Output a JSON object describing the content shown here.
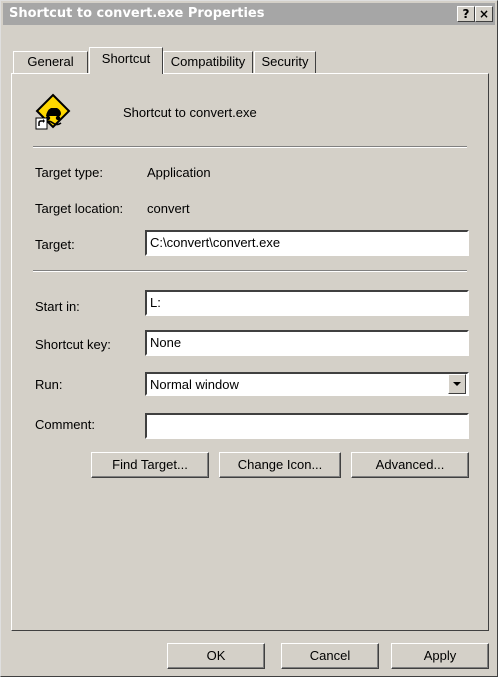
{
  "window": {
    "title": "Shortcut to convert.exe Properties"
  },
  "titlebar": {
    "help_label": "?",
    "close_label": "×"
  },
  "tabs": [
    {
      "label": "General"
    },
    {
      "label": "Shortcut"
    },
    {
      "label": "Compatibility"
    },
    {
      "label": "Security"
    }
  ],
  "header": {
    "name": "Shortcut to convert.exe",
    "icon": "driving-hazard-sign-icon"
  },
  "fields": {
    "target_type_label": "Target type:",
    "target_type_value": "Application",
    "target_location_label": "Target location:",
    "target_location_value": "convert",
    "target_label": "Target:",
    "target_value": "C:\\convert\\convert.exe",
    "start_in_label": "Start in:",
    "start_in_value": "L:",
    "shortcut_key_label": "Shortcut key:",
    "shortcut_key_value": "None",
    "run_label": "Run:",
    "run_value": "Normal window",
    "comment_label": "Comment:",
    "comment_value": ""
  },
  "actions": {
    "find_target": "Find Target...",
    "change_icon": "Change Icon...",
    "advanced": "Advanced..."
  },
  "footer": {
    "ok": "OK",
    "cancel": "Cancel",
    "apply": "Apply"
  },
  "colors": {
    "face": "#d4d0c8",
    "titlebar": "#a6a6a6",
    "icon_yellow": "#ffd800"
  }
}
